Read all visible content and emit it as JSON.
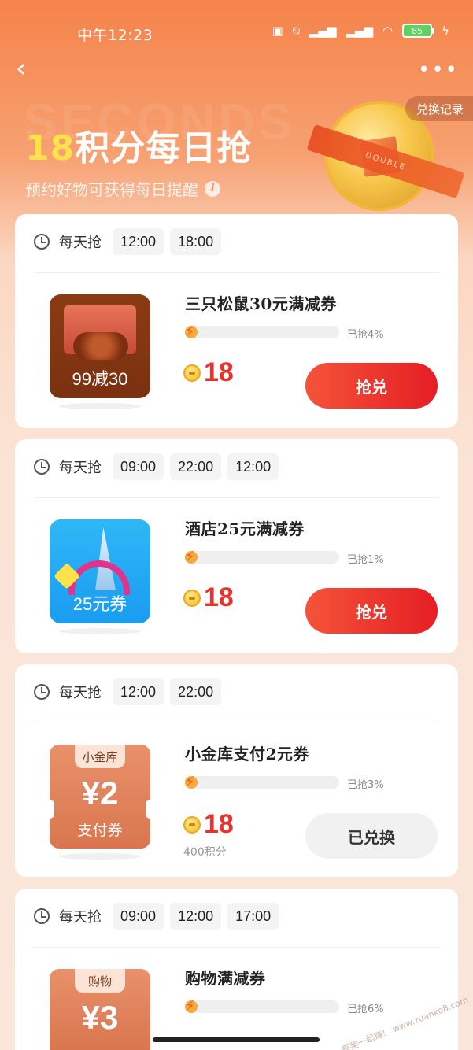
{
  "status_bar": {
    "time": "中午12:23",
    "battery": "85"
  },
  "header": {
    "watermark": "SECONDS",
    "title_num": "18",
    "title_rest": "积分每日抢",
    "subtitle": "预约好物可获得每日提醒",
    "history_button": "兑换记录",
    "ribbon_text": "DOUBLE"
  },
  "every_day_label": "每天抢",
  "cards": [
    {
      "times": [
        "12:00",
        "18:00"
      ],
      "thumb_label": "99减30",
      "title": "三只松鼠30元满减券",
      "progress_text": "已抢4%",
      "progress": 0.04,
      "price": "18",
      "button": "抢兑"
    },
    {
      "times": [
        "09:00",
        "22:00",
        "12:00"
      ],
      "thumb_label": "25元券",
      "title": "酒店25元满减券",
      "progress_text": "已抢1%",
      "progress": 0.01,
      "price": "18",
      "button": "抢兑"
    },
    {
      "times": [
        "12:00",
        "22:00"
      ],
      "thumb_tab": "小金库",
      "thumb_amount": "¥2",
      "thumb_kind": "支付券",
      "title": "小金库支付2元券",
      "progress_text": "已抢3%",
      "progress": 0.03,
      "price": "18",
      "orig_price": "400积分",
      "button": "已兑换"
    },
    {
      "times": [
        "09:00",
        "12:00",
        "17:00"
      ],
      "thumb_tab": "购物",
      "thumb_amount": "¥3",
      "title": "购物满减券",
      "progress_text": "已抢6%",
      "progress": 0.06
    }
  ],
  "site_watermark": "赚客吧，有奖一起赚！ www.zuanke8.com",
  "colors": {
    "accent_red": "#e8322b",
    "header_orange": "#f5834a",
    "progress_yellow": "#f7aa3a"
  }
}
